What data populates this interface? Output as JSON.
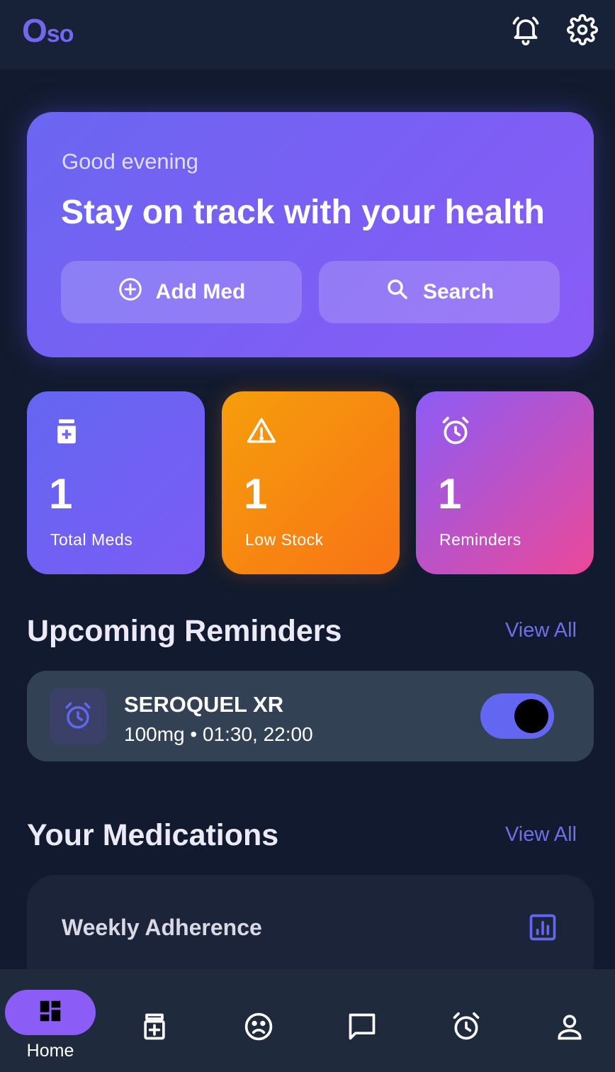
{
  "app": {
    "logo_big": "O",
    "logo_small": "so"
  },
  "hero": {
    "greeting": "Good evening",
    "headline": "Stay on track with your health",
    "add_med_label": "Add Med",
    "search_label": "Search"
  },
  "stats": [
    {
      "value": "1",
      "label": "Total Meds",
      "icon": "medicine-bottle-icon"
    },
    {
      "value": "1",
      "label": "Low Stock",
      "icon": "warning-icon"
    },
    {
      "value": "1",
      "label": "Reminders",
      "icon": "alarm-clock-icon"
    }
  ],
  "reminders_section": {
    "title": "Upcoming Reminders",
    "view_all": "View All",
    "items": [
      {
        "name": "SEROQUEL XR",
        "detail": "100mg • 01:30, 22:00",
        "enabled": true
      }
    ]
  },
  "medications_section": {
    "title": "Your Medications",
    "view_all": "View All"
  },
  "adherence": {
    "title": "Weekly Adherence"
  },
  "nav": {
    "items": [
      {
        "label": "Home",
        "icon": "dashboard-icon",
        "active": true
      },
      {
        "label": "",
        "icon": "medicine-bottle-icon"
      },
      {
        "label": "",
        "icon": "sad-face-icon"
      },
      {
        "label": "",
        "icon": "chat-icon"
      },
      {
        "label": "",
        "icon": "alarm-clock-icon"
      },
      {
        "label": "",
        "icon": "profile-icon"
      }
    ]
  },
  "colors": {
    "background": "#111a2e",
    "accent": "#6366f1",
    "orange": "#f97316",
    "pink": "#ec4899"
  }
}
